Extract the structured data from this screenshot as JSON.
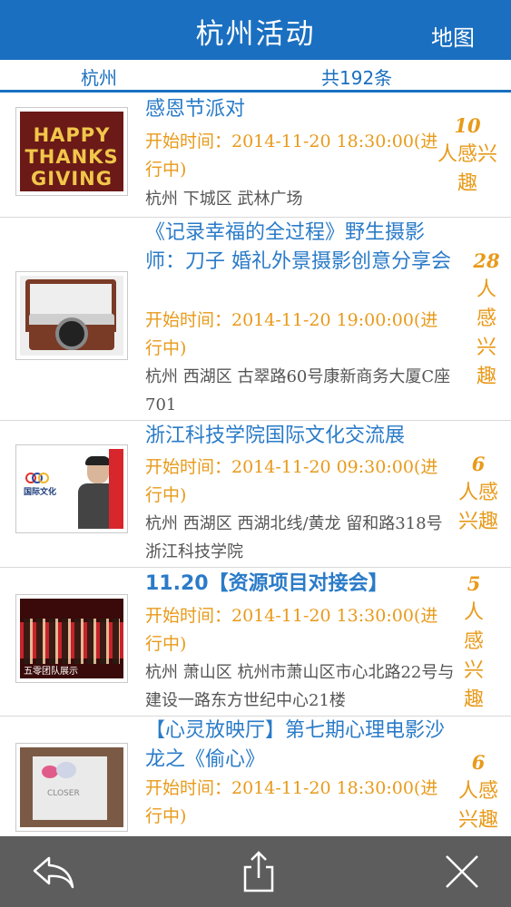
{
  "header": {
    "title": "杭州活动",
    "map_label": "地图"
  },
  "subbar": {
    "city": "杭州",
    "count": "共192条"
  },
  "colors": {
    "primary": "#1a6fc0",
    "time": "#e89a1a",
    "toolbar": "#5d5d5d"
  },
  "events": [
    {
      "title": "感恩节派对",
      "time": "开始时间：2014-11-20 18:30:00(进行中)",
      "address": "杭州 下城区 武林广场",
      "interest_count": "10",
      "interest_label": "人感兴趣",
      "thumb_text": [
        "HAPPY",
        "THANKS",
        "GIVING"
      ]
    },
    {
      "title": "《记录幸福的全过程》野生摄影师：刀子 婚礼外景摄影创意分享会",
      "time": "开始时间：2014-11-20 19:00:00(进行中)",
      "address": "杭州 西湖区 古翠路60号康新商务大厦C座701",
      "interest_count": "28",
      "interest_label": "人感兴趣"
    },
    {
      "title": "浙江科技学院国际文化交流展",
      "time": "开始时间：2014-11-20 09:30:00(进行中)",
      "address": "杭州 西湖区 西湖北线/黄龙 留和路318号浙江科技学院",
      "interest_count": "6",
      "interest_label": "人感兴趣",
      "thumb_text": "国际文化"
    },
    {
      "title": "11.20【资源项目对接会】",
      "time": "开始时间：2014-11-20 13:30:00(进行中)",
      "address": "杭州 萧山区 杭州市萧山区市心北路22号与建设一路东方世纪中心21楼",
      "interest_count": "5",
      "interest_label": "人感兴趣",
      "thumb_text": "五零团队展示"
    },
    {
      "title": "【心灵放映厅】第七期心理电影沙龙之《偷心》",
      "time": "开始时间：2014-11-20 18:30:00(进行中)",
      "address": "",
      "interest_count": "6",
      "interest_label": "人感兴趣",
      "thumb_text": "CLOSER"
    }
  ],
  "toolbar": {
    "icons": [
      "back-arrow-icon",
      "share-icon",
      "close-icon"
    ]
  }
}
